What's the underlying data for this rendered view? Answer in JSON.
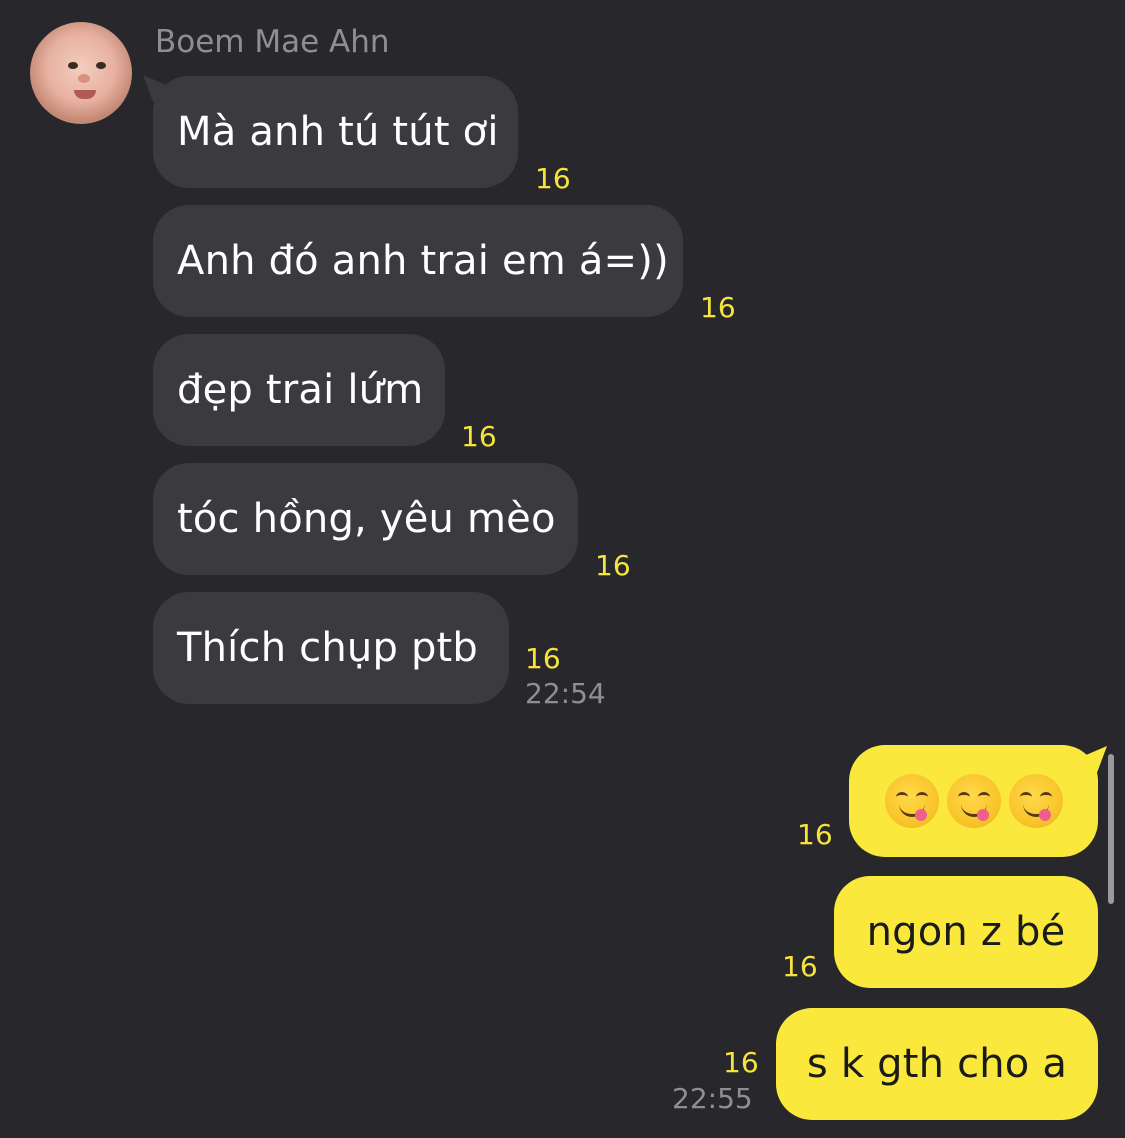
{
  "chat": {
    "sender": "Boem Mae Ahn",
    "incoming": [
      {
        "text": "Mà anh tú tút ơi",
        "count": "16"
      },
      {
        "text": "Anh đó anh trai em á=))",
        "count": "16"
      },
      {
        "text": "đẹp trai lứm",
        "count": "16"
      },
      {
        "text": "tóc hồng, yêu mèo",
        "count": "16"
      },
      {
        "text": "Thích chụp ptb",
        "count": "16"
      }
    ],
    "incoming_time": "22:54",
    "outgoing": [
      {
        "text": "",
        "count": "16"
      },
      {
        "text": "ngon z bé",
        "count": "16"
      },
      {
        "text": "s k gth cho a",
        "count": "16"
      }
    ],
    "outgoing_time": "22:55"
  },
  "icons": [
    "avatar",
    "face-savoring-food-emoji"
  ],
  "colors": {
    "background": "#28282c",
    "incoming_bubble": "#3b3b3f",
    "outgoing_bubble": "#fae83c",
    "unread_count": "#f6e33c",
    "timestamp": "#8e8e93"
  }
}
